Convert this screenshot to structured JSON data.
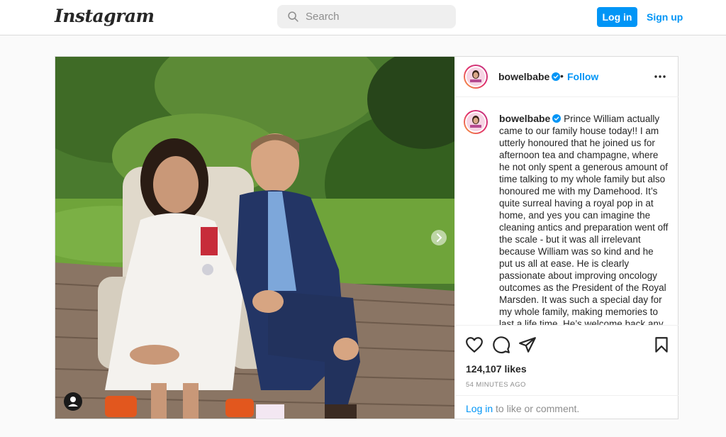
{
  "header": {
    "logo": "Instagram",
    "search_placeholder": "Search",
    "login_label": "Log in",
    "signup_label": "Sign up"
  },
  "post": {
    "username": "bowelbabe",
    "verified": true,
    "separator": "•",
    "follow_label": "Follow",
    "caption_visible": "Prince William actually came to our family house today!! I am utterly honoured that he joined us for afternoon tea and champagne, where he not only spent a generous amount of time talking to my whole family but also honoured me with my Damehood. It’s quite surreal having a royal pop in at home, and yes you can imagine the cleaning antics and preparation went off the scale - but it was all irrelevant because William was so kind and he put us all at ease. He is clearly passionate about improving oncology outcomes as the President of the Royal Marsden. It was such a special day for my whole family, making memories to last a life time. He’s welcome back any time!",
    "likes": "124,107 likes",
    "time_ago": "54 MINUTES AGO",
    "login_link": "Log in",
    "login_suffix": " to like or comment.",
    "icons": [
      "heart-icon",
      "comment-icon",
      "share-icon",
      "bookmark-icon",
      "more-options-icon",
      "next-arrow-icon",
      "user-tag-icon",
      "search-icon",
      "verified-badge-icon"
    ],
    "colors": {
      "accent": "#0095f6",
      "text": "#262626",
      "muted": "#8e8e8e"
    }
  }
}
